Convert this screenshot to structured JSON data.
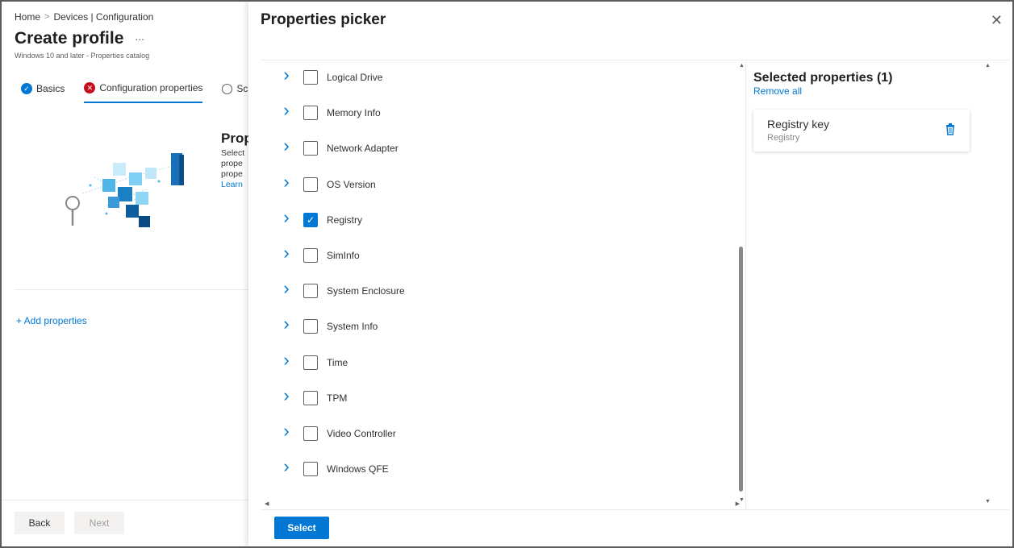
{
  "breadcrumb": {
    "home": "Home",
    "separator": ">",
    "section": "Devices | Configuration"
  },
  "page": {
    "title": "Create profile",
    "more_label": "...",
    "subtitle": "Windows 10 and later - Properties catalog"
  },
  "wizard_tabs": [
    {
      "label": "Basics",
      "state": "complete"
    },
    {
      "label": "Configuration properties",
      "state": "error"
    },
    {
      "label": "Sc",
      "state": "pending"
    }
  ],
  "properties_intro": {
    "heading": "Prop",
    "lines": [
      "Select",
      "prope",
      "prope"
    ],
    "learn_link": "Learn"
  },
  "add_properties_link": "+ Add properties",
  "footer_left": {
    "back_label": "Back",
    "next_label": "Next"
  },
  "panel": {
    "title": "Properties picker",
    "close_icon": "close-icon",
    "items": [
      {
        "label": "Logical Drive",
        "checked": false
      },
      {
        "label": "Memory Info",
        "checked": false
      },
      {
        "label": "Network Adapter",
        "checked": false
      },
      {
        "label": "OS Version",
        "checked": false
      },
      {
        "label": "Registry",
        "checked": true
      },
      {
        "label": "SimInfo",
        "checked": false
      },
      {
        "label": "System Enclosure",
        "checked": false
      },
      {
        "label": "System Info",
        "checked": false
      },
      {
        "label": "Time",
        "checked": false
      },
      {
        "label": "TPM",
        "checked": false
      },
      {
        "label": "Video Controller",
        "checked": false
      },
      {
        "label": "Windows QFE",
        "checked": false
      }
    ],
    "selected": {
      "title": "Selected properties (1)",
      "remove_all": "Remove all",
      "cards": [
        {
          "name": "Registry key",
          "category": "Registry"
        }
      ]
    },
    "select_button": "Select"
  },
  "colors": {
    "accent": "#0078d4",
    "error": "#c50f1f",
    "text": "#323130"
  }
}
